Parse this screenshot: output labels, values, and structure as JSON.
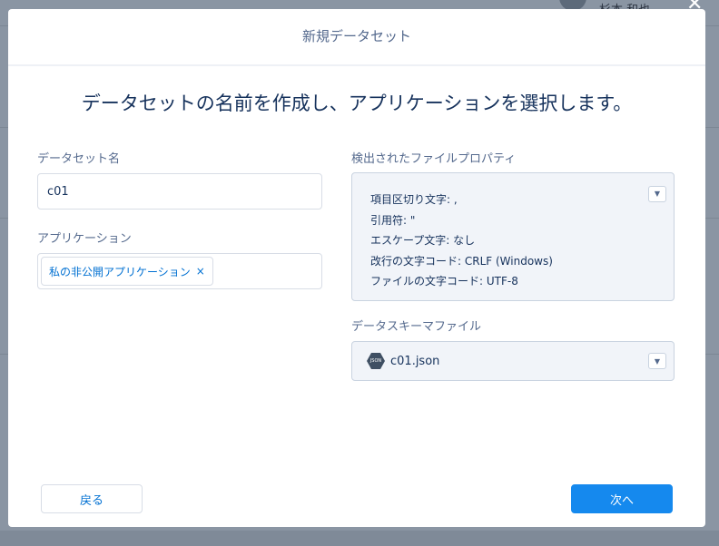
{
  "background": {
    "user_name": "杉本 和也"
  },
  "modal": {
    "title": "新規データセット",
    "headline": "データセットの名前を作成し、アプリケーションを選択します。",
    "dataset_name_label": "データセット名",
    "dataset_name_value": "c01",
    "application_label": "アプリケーション",
    "application_pill": "私の非公開アプリケーション",
    "pill_remove": "×",
    "detected_label": "検出されたファイルプロパティ",
    "properties": [
      "項目区切り文字: ,",
      "引用符: \"",
      "エスケープ文字: なし",
      "改行の文字コード: CRLF (Windows)",
      "ファイルの文字コード: UTF-8"
    ],
    "schema_label": "データスキーマファイル",
    "schema_file": "c01.json",
    "json_icon_text": "JSON",
    "back_button": "戻る",
    "next_button": "次へ"
  },
  "colors": {
    "accent": "#1589ee"
  }
}
